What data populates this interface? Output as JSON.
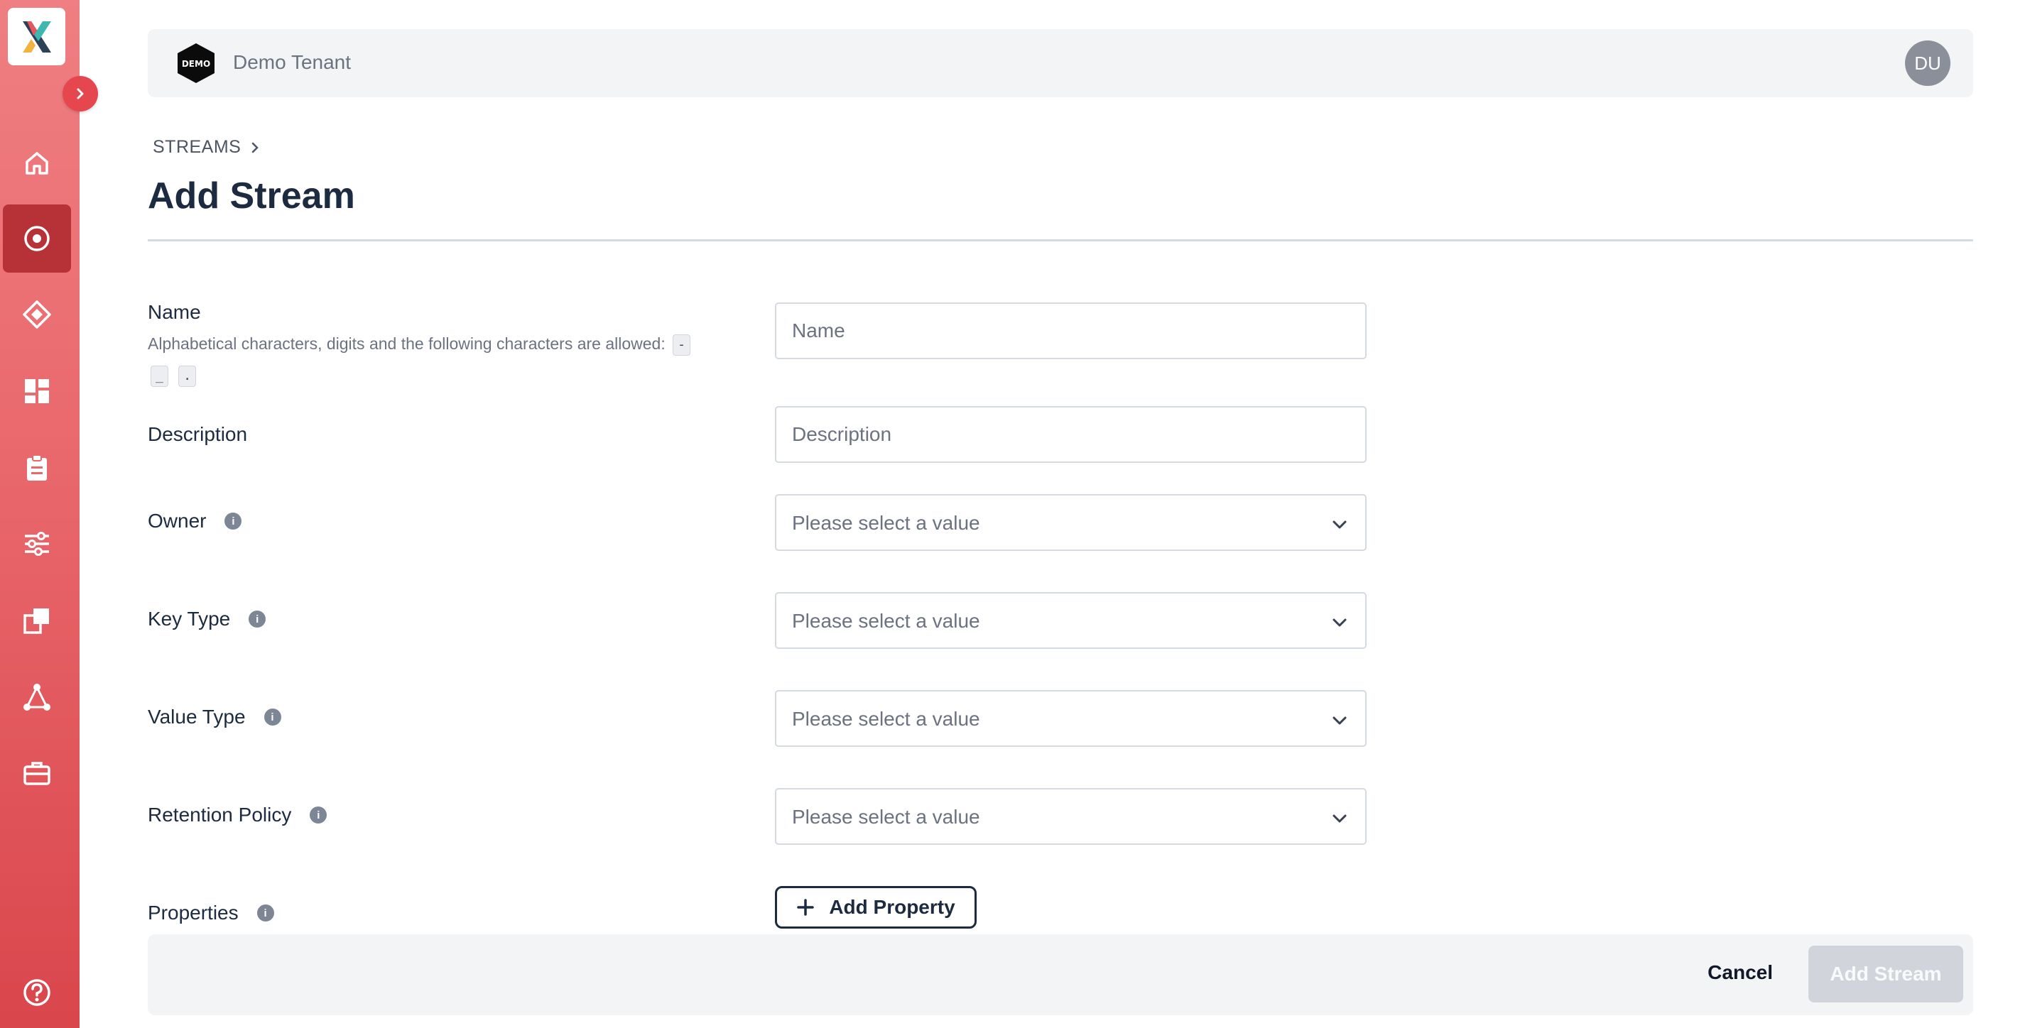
{
  "sidebar": {
    "logo": "x-logo",
    "expand_icon": "chevron-right-icon",
    "items": [
      {
        "icon": "home-icon",
        "active": false
      },
      {
        "icon": "streams-icon",
        "active": true
      },
      {
        "icon": "diamond-icon",
        "active": false
      },
      {
        "icon": "grid-icon",
        "active": false
      },
      {
        "icon": "clipboard-icon",
        "active": false
      },
      {
        "icon": "sliders-icon",
        "active": false
      },
      {
        "icon": "copy-icon",
        "active": false
      },
      {
        "icon": "triangle-nodes-icon",
        "active": false
      },
      {
        "icon": "toolbox-icon",
        "active": false
      }
    ],
    "help_icon": "help-circle-icon"
  },
  "header": {
    "tenant_badge": "DEMO",
    "tenant_name": "Demo Tenant",
    "avatar_initials": "DU"
  },
  "breadcrumb": {
    "items": [
      "STREAMS"
    ]
  },
  "page": {
    "title": "Add Stream"
  },
  "form": {
    "name": {
      "label": "Name",
      "hint": "Alphabetical characters, digits and the following characters are allowed:",
      "allowed_chars": [
        "-",
        "_",
        "."
      ],
      "placeholder": "Name",
      "value": ""
    },
    "description": {
      "label": "Description",
      "placeholder": "Description",
      "value": ""
    },
    "owner": {
      "label": "Owner",
      "value": "Please select a value"
    },
    "key_type": {
      "label": "Key Type",
      "value": "Please select a value"
    },
    "value_type": {
      "label": "Value Type",
      "value": "Please select a value"
    },
    "retention_policy": {
      "label": "Retention Policy",
      "value": "Please select a value"
    },
    "properties": {
      "label": "Properties",
      "add_label": "Add Property"
    }
  },
  "footer": {
    "cancel_label": "Cancel",
    "submit_label": "Add Stream"
  },
  "colors": {
    "sidebar_top": "#ef7f82",
    "sidebar_bottom": "#d9464c",
    "sidebar_active": "#b73237",
    "title": "#1c2b3f",
    "disabled_button": "#d1d5db"
  }
}
